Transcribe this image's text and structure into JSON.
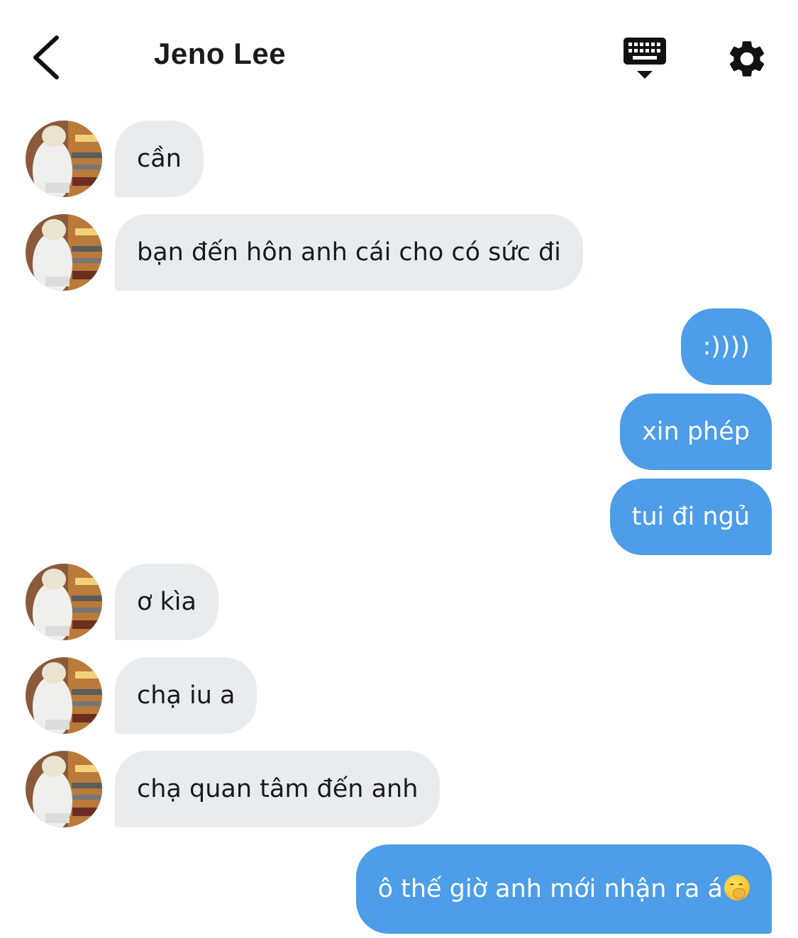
{
  "header": {
    "title": "Jeno Lee",
    "back_icon": "chevron-left-icon",
    "keyboard_icon": "keyboard-icon",
    "settings_icon": "gear-icon"
  },
  "colors": {
    "incoming_bubble": "#e8ecef",
    "outgoing_bubble": "#4d9de8",
    "title_text": "#1b1b1b"
  },
  "messages": [
    {
      "from": "contact",
      "text": "cần"
    },
    {
      "from": "contact",
      "text": "bạn đến hôn anh cái cho có sức đi"
    },
    {
      "from": "me",
      "text": ":))))"
    },
    {
      "from": "me",
      "text": "xin phép"
    },
    {
      "from": "me",
      "text": "tui đi ngủ"
    },
    {
      "from": "contact",
      "text": "ơ kìa"
    },
    {
      "from": "contact",
      "text": "chạ iu a"
    },
    {
      "from": "contact",
      "text": "chạ quan tâm đến anh"
    },
    {
      "from": "me",
      "text": "ô thế giờ anh mới nhận ra á",
      "emoji": "face-with-hand-over-mouth"
    }
  ]
}
